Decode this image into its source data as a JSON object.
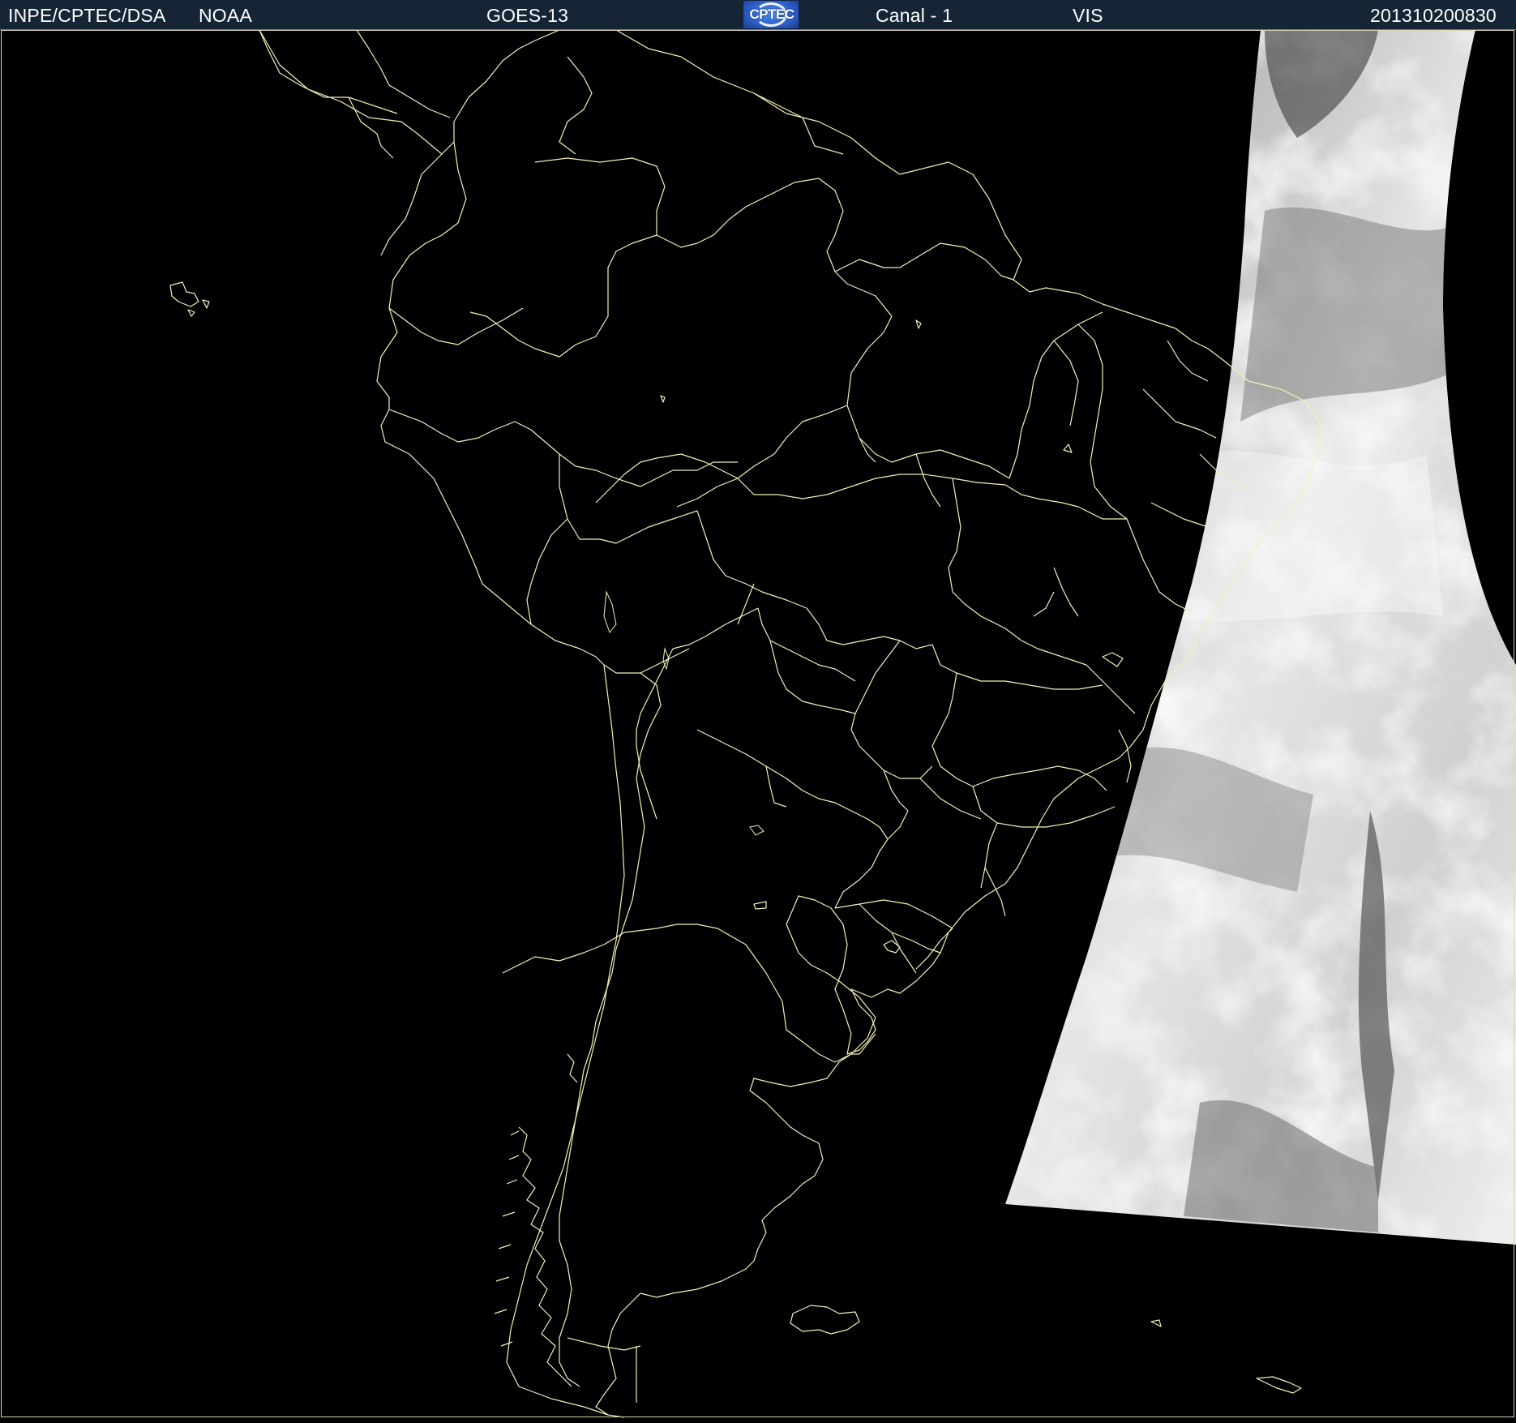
{
  "header": {
    "agency": "INPE/CPTEC/DSA",
    "source": "NOAA",
    "satellite": "GOES-13",
    "logo_text": "CPTEC",
    "channel": "Canal - 1",
    "band": "VIS",
    "datetime": "201310200830"
  },
  "colors": {
    "header_bg": "#162536",
    "map_bg": "#000000",
    "boundary_lines": "#f4f0b8",
    "cloud_bright": "#f0f0f0",
    "cloud_gray": "#8a8a8a"
  },
  "icons": {
    "logo": "cptec-logo-icon"
  }
}
